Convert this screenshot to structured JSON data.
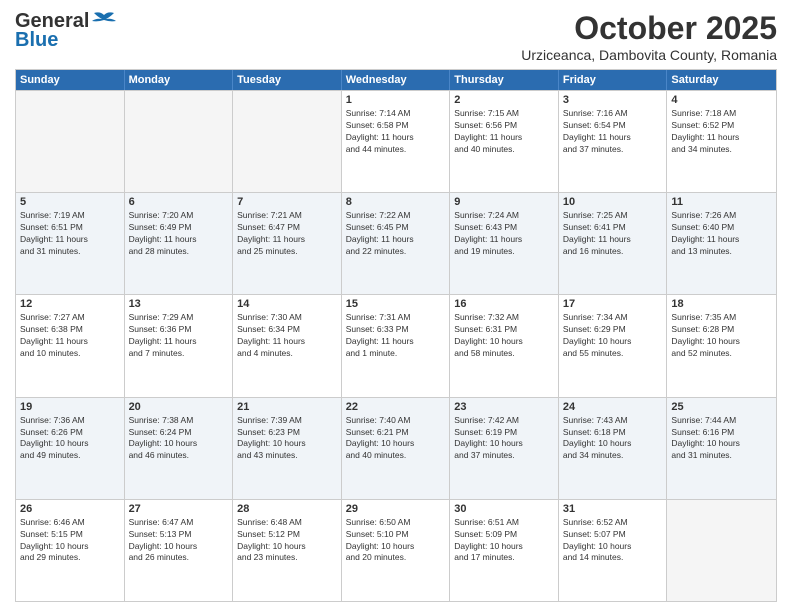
{
  "header": {
    "logo_general": "General",
    "logo_blue": "Blue",
    "month_title": "October 2025",
    "subtitle": "Urziceanca, Dambovita County, Romania"
  },
  "calendar": {
    "days_of_week": [
      "Sunday",
      "Monday",
      "Tuesday",
      "Wednesday",
      "Thursday",
      "Friday",
      "Saturday"
    ],
    "rows": [
      [
        {
          "day": "",
          "empty": true
        },
        {
          "day": "",
          "empty": true
        },
        {
          "day": "",
          "empty": true
        },
        {
          "day": "1",
          "info": "Sunrise: 7:14 AM\nSunset: 6:58 PM\nDaylight: 11 hours\nand 44 minutes."
        },
        {
          "day": "2",
          "info": "Sunrise: 7:15 AM\nSunset: 6:56 PM\nDaylight: 11 hours\nand 40 minutes."
        },
        {
          "day": "3",
          "info": "Sunrise: 7:16 AM\nSunset: 6:54 PM\nDaylight: 11 hours\nand 37 minutes."
        },
        {
          "day": "4",
          "info": "Sunrise: 7:18 AM\nSunset: 6:52 PM\nDaylight: 11 hours\nand 34 minutes."
        }
      ],
      [
        {
          "day": "5",
          "info": "Sunrise: 7:19 AM\nSunset: 6:51 PM\nDaylight: 11 hours\nand 31 minutes."
        },
        {
          "day": "6",
          "info": "Sunrise: 7:20 AM\nSunset: 6:49 PM\nDaylight: 11 hours\nand 28 minutes."
        },
        {
          "day": "7",
          "info": "Sunrise: 7:21 AM\nSunset: 6:47 PM\nDaylight: 11 hours\nand 25 minutes."
        },
        {
          "day": "8",
          "info": "Sunrise: 7:22 AM\nSunset: 6:45 PM\nDaylight: 11 hours\nand 22 minutes."
        },
        {
          "day": "9",
          "info": "Sunrise: 7:24 AM\nSunset: 6:43 PM\nDaylight: 11 hours\nand 19 minutes."
        },
        {
          "day": "10",
          "info": "Sunrise: 7:25 AM\nSunset: 6:41 PM\nDaylight: 11 hours\nand 16 minutes."
        },
        {
          "day": "11",
          "info": "Sunrise: 7:26 AM\nSunset: 6:40 PM\nDaylight: 11 hours\nand 13 minutes."
        }
      ],
      [
        {
          "day": "12",
          "info": "Sunrise: 7:27 AM\nSunset: 6:38 PM\nDaylight: 11 hours\nand 10 minutes."
        },
        {
          "day": "13",
          "info": "Sunrise: 7:29 AM\nSunset: 6:36 PM\nDaylight: 11 hours\nand 7 minutes."
        },
        {
          "day": "14",
          "info": "Sunrise: 7:30 AM\nSunset: 6:34 PM\nDaylight: 11 hours\nand 4 minutes."
        },
        {
          "day": "15",
          "info": "Sunrise: 7:31 AM\nSunset: 6:33 PM\nDaylight: 11 hours\nand 1 minute."
        },
        {
          "day": "16",
          "info": "Sunrise: 7:32 AM\nSunset: 6:31 PM\nDaylight: 10 hours\nand 58 minutes."
        },
        {
          "day": "17",
          "info": "Sunrise: 7:34 AM\nSunset: 6:29 PM\nDaylight: 10 hours\nand 55 minutes."
        },
        {
          "day": "18",
          "info": "Sunrise: 7:35 AM\nSunset: 6:28 PM\nDaylight: 10 hours\nand 52 minutes."
        }
      ],
      [
        {
          "day": "19",
          "info": "Sunrise: 7:36 AM\nSunset: 6:26 PM\nDaylight: 10 hours\nand 49 minutes."
        },
        {
          "day": "20",
          "info": "Sunrise: 7:38 AM\nSunset: 6:24 PM\nDaylight: 10 hours\nand 46 minutes."
        },
        {
          "day": "21",
          "info": "Sunrise: 7:39 AM\nSunset: 6:23 PM\nDaylight: 10 hours\nand 43 minutes."
        },
        {
          "day": "22",
          "info": "Sunrise: 7:40 AM\nSunset: 6:21 PM\nDaylight: 10 hours\nand 40 minutes."
        },
        {
          "day": "23",
          "info": "Sunrise: 7:42 AM\nSunset: 6:19 PM\nDaylight: 10 hours\nand 37 minutes."
        },
        {
          "day": "24",
          "info": "Sunrise: 7:43 AM\nSunset: 6:18 PM\nDaylight: 10 hours\nand 34 minutes."
        },
        {
          "day": "25",
          "info": "Sunrise: 7:44 AM\nSunset: 6:16 PM\nDaylight: 10 hours\nand 31 minutes."
        }
      ],
      [
        {
          "day": "26",
          "info": "Sunrise: 6:46 AM\nSunset: 5:15 PM\nDaylight: 10 hours\nand 29 minutes."
        },
        {
          "day": "27",
          "info": "Sunrise: 6:47 AM\nSunset: 5:13 PM\nDaylight: 10 hours\nand 26 minutes."
        },
        {
          "day": "28",
          "info": "Sunrise: 6:48 AM\nSunset: 5:12 PM\nDaylight: 10 hours\nand 23 minutes."
        },
        {
          "day": "29",
          "info": "Sunrise: 6:50 AM\nSunset: 5:10 PM\nDaylight: 10 hours\nand 20 minutes."
        },
        {
          "day": "30",
          "info": "Sunrise: 6:51 AM\nSunset: 5:09 PM\nDaylight: 10 hours\nand 17 minutes."
        },
        {
          "day": "31",
          "info": "Sunrise: 6:52 AM\nSunset: 5:07 PM\nDaylight: 10 hours\nand 14 minutes."
        },
        {
          "day": "",
          "empty": true
        }
      ]
    ]
  }
}
